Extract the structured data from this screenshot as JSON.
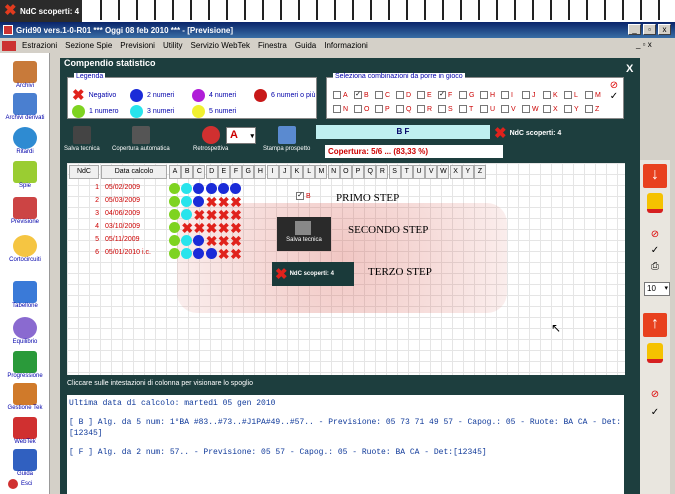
{
  "tab": {
    "label": "NdC scoperti: 4"
  },
  "window": {
    "title": "Grid90 vers.1-0-R01  ***  Oggi 08 feb 2010  ***  - [Previsione]",
    "minimize": "_",
    "restore": "▫",
    "close": "x"
  },
  "menu": [
    "Estrazioni",
    "Sezione Spie",
    "Previsioni",
    "Utility",
    "Servizio WebTek",
    "Finestra",
    "Guida",
    "Informazioni"
  ],
  "sidebar": [
    {
      "label": "Archivi",
      "color": "#c87a3a"
    },
    {
      "label": "Archivi derivati",
      "color": "#4a7fd0"
    },
    {
      "label": "Ritardi",
      "color": "#2e8bd2"
    },
    {
      "label": "Spie",
      "color": "#9acd32"
    },
    {
      "label": "Previsione",
      "color": "#c44"
    },
    {
      "label": "Cortocircuiti",
      "color": "#f5c542"
    },
    {
      "label": "Tabellone",
      "color": "#3a7ad8"
    },
    {
      "label": "Equilibrio",
      "color": "#8a6ad0"
    },
    {
      "label": "Progressione",
      "color": "#2a9a3a"
    },
    {
      "label": "Gestione Tek",
      "color": "#d07a2a"
    },
    {
      "label": "WebTek",
      "color": "#d03030"
    },
    {
      "label": "Guida",
      "color": "#3060c0"
    },
    {
      "label": "Esci",
      "color": "#d03030"
    }
  ],
  "panel": {
    "title": "Compendio statistico",
    "close": "X"
  },
  "legend": {
    "title": "Legenda",
    "items": [
      {
        "label": "Negativo",
        "color": "#e0221c"
      },
      {
        "label": "2 numeri",
        "color": "#1a2bd8"
      },
      {
        "label": "4 numeri",
        "color": "#b01ed8"
      },
      {
        "label": "6 numeri o più",
        "color": "#c81818"
      },
      {
        "label": "1 numero",
        "color": "#7ed321"
      },
      {
        "label": "3 numeri",
        "color": "#28e4ec"
      },
      {
        "label": "5 numeri",
        "color": "#f0f030"
      }
    ]
  },
  "combos": {
    "title": "Seleziona combinazioni da porre in gioco",
    "row1": [
      "A",
      "B",
      "C",
      "D",
      "E",
      "F",
      "G",
      "H",
      "I",
      "J",
      "K",
      "L",
      "M"
    ],
    "row2": [
      "N",
      "O",
      "P",
      "Q",
      "R",
      "S",
      "T",
      "U",
      "V",
      "W",
      "X",
      "Y",
      "Z"
    ],
    "checked": [
      "B",
      "F"
    ]
  },
  "tools": {
    "salva": "Salva tecnica",
    "copertura": "Copertura automatica",
    "retro": "Retrospettiva",
    "select_value": "A",
    "stampa": "Stampa prospetto",
    "bf": "B F",
    "ndc": "NdC scoperti: 4",
    "copertura_text": "Copertura: 5/6 ... (83,33 %)"
  },
  "grid": {
    "headers": [
      "NdC",
      "Data calcolo"
    ],
    "letters": [
      "A",
      "B",
      "C",
      "D",
      "E",
      "F",
      "G",
      "H",
      "I",
      "J",
      "K",
      "L",
      "M",
      "N",
      "O",
      "P",
      "Q",
      "R",
      "S",
      "T",
      "U",
      "V",
      "W",
      "X",
      "Y",
      "Z"
    ],
    "rows": [
      {
        "ndc": "1",
        "date": "05/02/2009",
        "cells": [
          "g",
          "c",
          "b",
          "b",
          "b",
          "b"
        ]
      },
      {
        "ndc": "2",
        "date": "05/03/2009",
        "cells": [
          "g",
          "c",
          "b",
          "x",
          "x",
          "x"
        ]
      },
      {
        "ndc": "3",
        "date": "04/06/2009",
        "cells": [
          "g",
          "c",
          "x",
          "x",
          "x",
          "x"
        ]
      },
      {
        "ndc": "4",
        "date": "03/10/2009",
        "cells": [
          "g",
          "x",
          "x",
          "x",
          "x",
          "x"
        ]
      },
      {
        "ndc": "5",
        "date": "05/11/2009",
        "cells": [
          "g",
          "c",
          "b",
          "x",
          "x",
          "x"
        ]
      },
      {
        "ndc": "6",
        "date": "05/01/2010 i.c.",
        "cells": [
          "g",
          "c",
          "b",
          "b",
          "x",
          "x"
        ]
      }
    ],
    "checkbox_label": "B",
    "step1": "PRIMO STEP",
    "step2": "SECONDO STEP",
    "step3": "TERZO STEP",
    "salva_label": "Salva tecnica",
    "ndc_label": "NdC scoperti: 4"
  },
  "hint": "Cliccare sulle intestazioni di colonna per visionare lo spoglio",
  "report": {
    "line1": "Ultima data di calcolo: martedì 05 gen 2010",
    "line2": "[ B ] Alg. da 5 num:  1°BA #83..#73..#J1PA#49..#57.. - Previsione: 05 73 71 49 57 - Capog.: 05 - Ruote: BA CA - Det:[12345]",
    "line3": "[ F ] Alg. da 2 num:  57.. - Previsione: 05 57 - Capog.: 05 - Ruote: BA CA - Det:[12345]"
  },
  "right": {
    "zoom": "10"
  }
}
